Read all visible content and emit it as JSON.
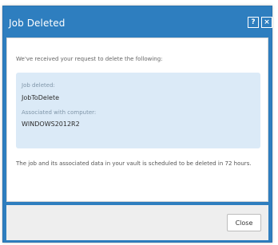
{
  "dialog": {
    "title": "Job Deleted",
    "help_button": "?",
    "close_icon": "×",
    "colors": {
      "accent": "#2e7ebf",
      "info_box": "#dbeaf7"
    }
  },
  "message": {
    "intro": "We've received your request to delete the following:",
    "job_label": "Job deleted:",
    "job_value": "JobToDelete",
    "computer_label": "Associated with computer:",
    "computer_value": "WINDOWS2012R2",
    "note": "The job and its associated data in your vault is scheduled to be deleted in 72 hours."
  },
  "footer": {
    "close_label": "Close"
  }
}
